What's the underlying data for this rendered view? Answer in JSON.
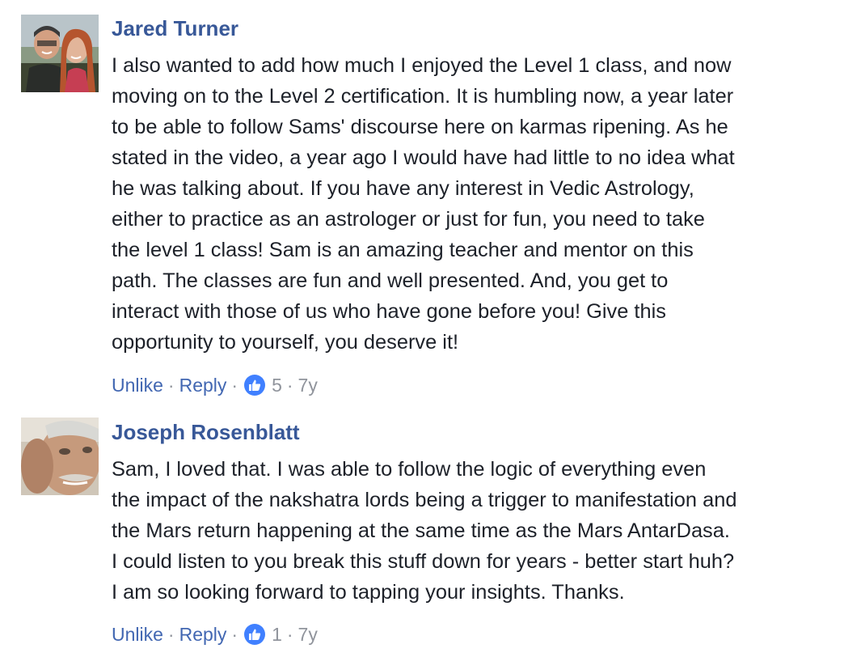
{
  "comments": [
    {
      "author": "Jared Turner",
      "text": "I also wanted to add how much I enjoyed the Level 1 class, and now\nmoving on to the Level 2 certification. It is humbling now, a year later\nto be able to follow Sams' discourse here on karmas ripening. As he\nstated in the video, a year ago I would have had little to no idea what\nhe was talking about. If you have any interest in Vedic Astrology,\neither to practice as an astrologer or just for fun, you need to take\nthe level 1 class! Sam is an amazing teacher and mentor on this\npath. The classes are fun and well presented. And, you get to\ninteract with those of us who have gone before you! Give this\nopportunity to yourself, you deserve it!",
      "unlike_label": "Unlike",
      "reply_label": "Reply",
      "like_count": "5",
      "time": "7y",
      "avatar_icon": "user-photo-couple"
    },
    {
      "author": "Joseph Rosenblatt",
      "text": "Sam, I loved that. I was able to follow the logic of everything even\nthe impact of the nakshatra lords being a trigger to manifestation and\nthe Mars return happening at the same time as the Mars AntarDasa.\nI could listen to you break this stuff down for years - better start huh?\nI am so looking forward to tapping your insights. Thanks.",
      "unlike_label": "Unlike",
      "reply_label": "Reply",
      "like_count": "1",
      "time": "7y",
      "avatar_icon": "user-photo-closeup"
    }
  ],
  "separator": "·",
  "colors": {
    "author": "#385898",
    "link": "#4267b2",
    "meta": "#90949c",
    "like_badge": "#4080ff",
    "text": "#1d2129"
  }
}
